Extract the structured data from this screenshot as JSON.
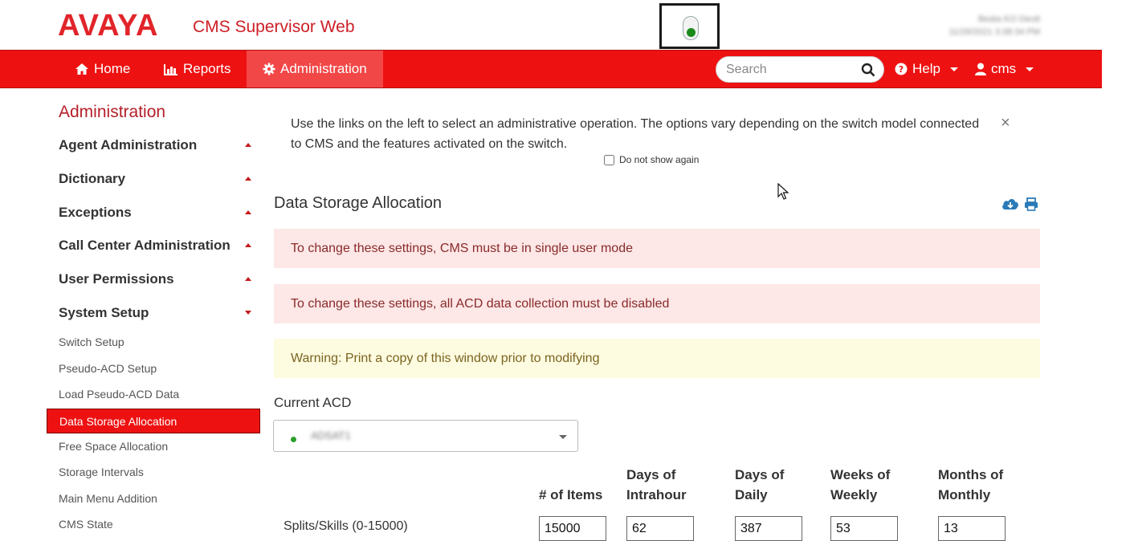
{
  "header": {
    "logo_text": "AVAYA",
    "app_title": "CMS Supervisor Web",
    "status_color": "#1a8a1a",
    "user_info_line1": "Beata KO Deutt",
    "user_info_line2": "11/29/2021 3:38:34 PM"
  },
  "navbar": {
    "home_label": "Home",
    "reports_label": "Reports",
    "administration_label": "Administration",
    "search_placeholder": "Search",
    "help_label": "Help",
    "user_label": "cms"
  },
  "sidebar": {
    "title": "Administration",
    "sections": {
      "agent_admin": "Agent Administration",
      "dictionary": "Dictionary",
      "exceptions": "Exceptions",
      "call_center_admin": "Call Center Administration",
      "user_permissions": "User Permissions",
      "system_setup": "System Setup"
    },
    "links": {
      "switch_setup": "Switch Setup",
      "pseudo_acd_setup": "Pseudo-ACD Setup",
      "load_pseudo_acd": "Load Pseudo-ACD Data",
      "data_storage_allocation": "Data Storage Allocation",
      "free_space_allocation": "Free Space Allocation",
      "storage_intervals": "Storage Intervals",
      "main_menu_addition": "Main Menu Addition",
      "cms_state": "CMS State"
    }
  },
  "main": {
    "info_text": "Use the links on the left to select an administrative operation. The options vary depending on the switch model connected to CMS and the features activated on the switch.",
    "close_symbol": "×",
    "dont_show_label": "Do not show again",
    "section_title": "Data Storage Allocation",
    "alert_single_user": "To change these settings, CMS must be in single user mode",
    "alert_acd_disabled": "To change these settings, all ACD data collection must be disabled",
    "warning_print": "Warning: Print a copy of this window prior to modifying",
    "current_acd_label": "Current ACD",
    "current_acd_value": "ADSAT1",
    "columns": {
      "items": "# of Items",
      "intrahour_line1": "Days of",
      "intrahour_line2": "Intrahour",
      "daily_line1": "Days of",
      "daily_line2": "Daily",
      "weekly_line1": "Weeks of",
      "weekly_line2": "Weekly",
      "monthly_line1": "Months of",
      "monthly_line2": "Monthly"
    },
    "rows": [
      {
        "label": "Splits/Skills (0-15000)",
        "items": "15000",
        "intrahour": "62",
        "daily": "387",
        "weekly": "53",
        "monthly": "13"
      }
    ]
  },
  "colors": {
    "brand_red": "#e1252a",
    "nav_red": "#ee1111",
    "danger_bg": "#fde7e7",
    "warn_bg": "#fdfbe0",
    "icon_blue": "#2a7ab8"
  }
}
